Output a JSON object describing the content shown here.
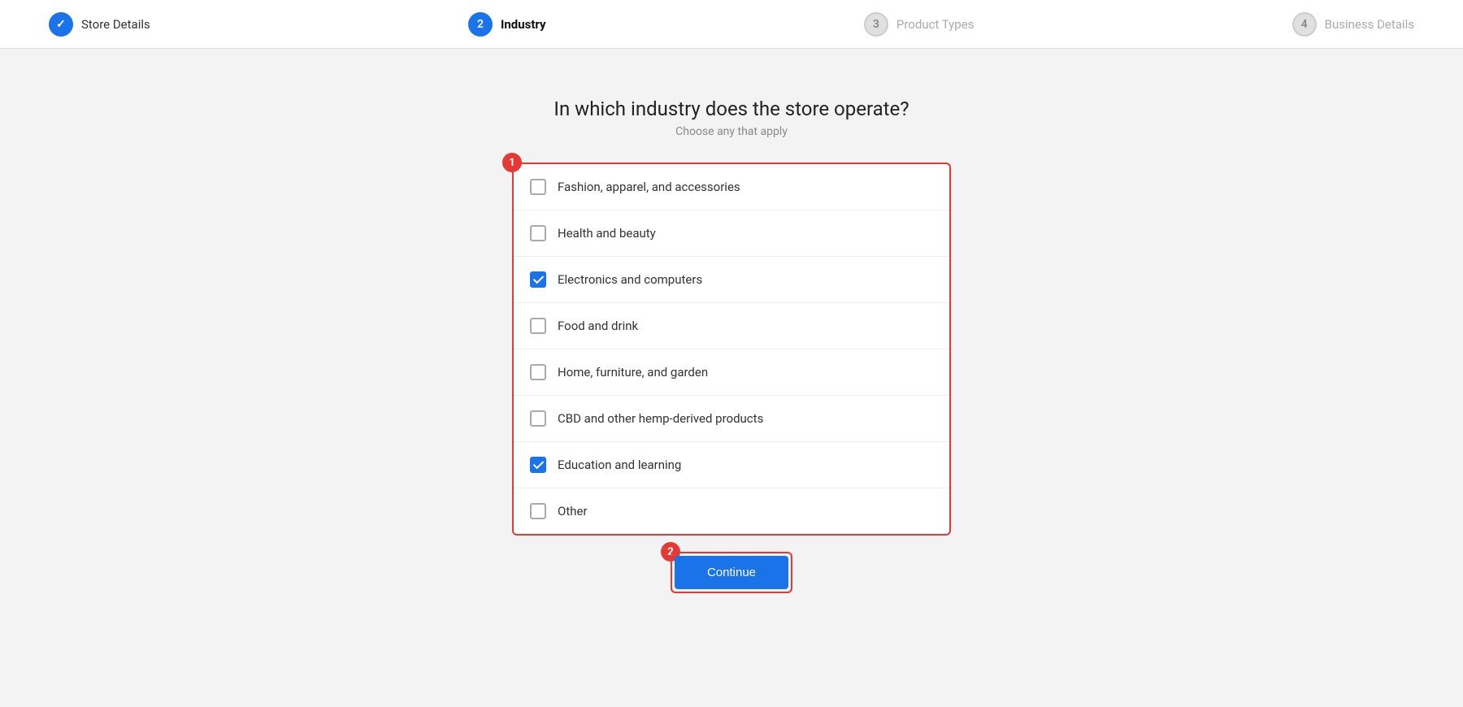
{
  "stepper": {
    "steps": [
      {
        "id": "store-details",
        "number": "✓",
        "label": "Store Details",
        "state": "completed"
      },
      {
        "id": "industry",
        "number": "2",
        "label": "Industry",
        "state": "active"
      },
      {
        "id": "product-types",
        "number": "3",
        "label": "Product Types",
        "state": "inactive"
      },
      {
        "id": "business-details",
        "number": "4",
        "label": "Business Details",
        "state": "inactive"
      }
    ]
  },
  "page": {
    "title": "In which industry does the store operate?",
    "subtitle": "Choose any that apply"
  },
  "checklist": {
    "items": [
      {
        "id": "fashion",
        "label": "Fashion, apparel, and accessories",
        "checked": false
      },
      {
        "id": "health",
        "label": "Health and beauty",
        "checked": false
      },
      {
        "id": "electronics",
        "label": "Electronics and computers",
        "checked": true
      },
      {
        "id": "food",
        "label": "Food and drink",
        "checked": false
      },
      {
        "id": "home",
        "label": "Home, furniture, and garden",
        "checked": false
      },
      {
        "id": "cbd",
        "label": "CBD and other hemp-derived products",
        "checked": false
      },
      {
        "id": "education",
        "label": "Education and learning",
        "checked": true
      },
      {
        "id": "other",
        "label": "Other",
        "checked": false
      }
    ]
  },
  "continue_button": {
    "label": "Continue"
  },
  "annotations": {
    "badge1": "1",
    "badge2": "2"
  }
}
